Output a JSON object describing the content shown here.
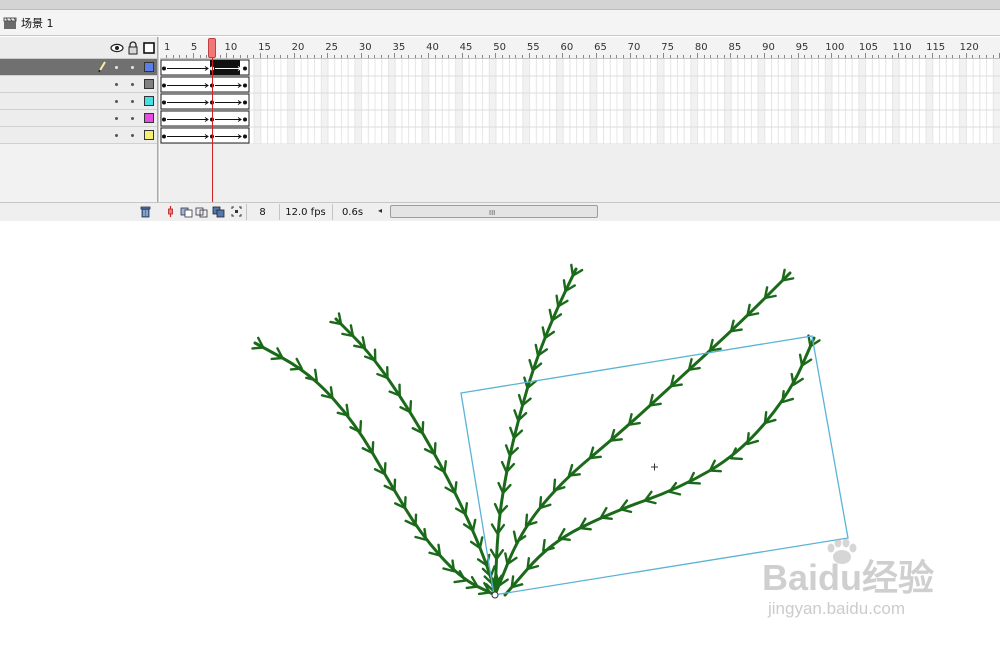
{
  "scene": {
    "label": "场景 1",
    "icon": "clapper-icon"
  },
  "timeline": {
    "header_icons": [
      "eye-icon",
      "lock-icon",
      "outline-icon"
    ],
    "ruler_labels": [
      "1",
      "5",
      "10",
      "15",
      "20",
      "25",
      "30",
      "35",
      "40",
      "45",
      "50",
      "55",
      "60",
      "65",
      "70",
      "75",
      "80",
      "85",
      "90",
      "95",
      "100",
      "105",
      "110",
      "115",
      "120"
    ],
    "current_frame_label": "8",
    "layers": [
      {
        "selected": true,
        "color": "#5b7fe8",
        "editing": true
      },
      {
        "selected": false,
        "color": "#808080",
        "editing": false
      },
      {
        "selected": false,
        "color": "#45e0e6",
        "editing": false
      },
      {
        "selected": false,
        "color": "#e24fe0",
        "editing": false
      },
      {
        "selected": false,
        "color": "#f4f070",
        "editing": false
      }
    ],
    "status": {
      "current_frame": "8",
      "frame_rate": "12.0 fps",
      "elapsed_time": "0.6s",
      "scroll_grip": "III"
    }
  },
  "stage": {
    "plant_color": "#1a6a1a",
    "selection_color": "#5ab3d6"
  },
  "watermark": {
    "brand": "Baidu经验",
    "url": "jingyan.baidu.com"
  }
}
